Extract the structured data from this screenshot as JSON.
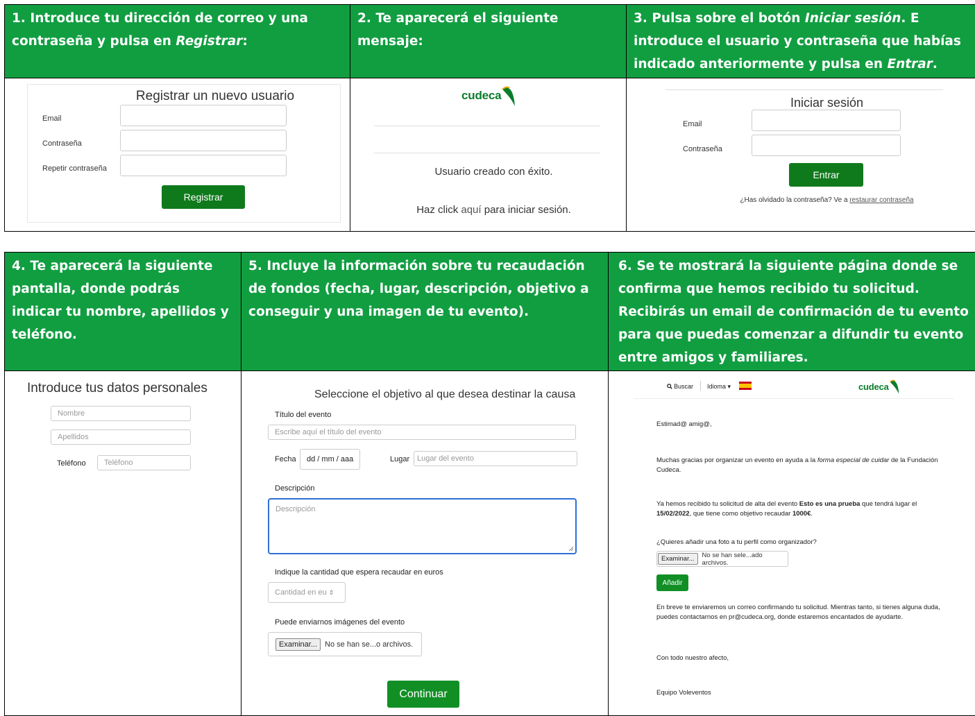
{
  "row1": {
    "step1": {
      "heading_pre": "1. Introduce tu dirección de correo y una contraseña y pulsa en ",
      "heading_em": "Registrar",
      "heading_post": ":",
      "form_title": "Registrar un nuevo usuario",
      "email_label": "Email",
      "password_label": "Contraseña",
      "repeat_label": "Repetir contraseña",
      "submit_label": "Registrar"
    },
    "step2": {
      "heading": "2. Te aparecerá el siguiente mensaje:",
      "logo_text": "cudeca",
      "success_text": "Usuario creado con éxito.",
      "click_pre": "Haz click ",
      "click_link": "aquí",
      "click_post": " para iniciar sesión."
    },
    "step3": {
      "heading_pre": "3. Pulsa sobre el botón ",
      "heading_em1": "Iniciar sesión",
      "heading_mid": ". E introduce el usuario y contraseña que habías indicado anteriormente y pulsa en ",
      "heading_em2": "Entrar",
      "heading_post": ".",
      "form_title": "Iniciar sesión",
      "email_label": "Email",
      "password_label": "Contraseña",
      "submit_label": "Entrar",
      "forgot_pre": "¿Has olvidado la contraseña? Ve a ",
      "forgot_link": "restaurar contraseña"
    }
  },
  "row2": {
    "step4": {
      "heading": "4. Te aparecerá la siguiente pantalla, donde podrás indicar tu nombre, apellidos y teléfono.",
      "form_title": "Introduce tus datos personales",
      "name_placeholder": "Nombre",
      "surname_placeholder": "Apellidos",
      "phone_label": "Teléfono",
      "phone_placeholder": "Teléfono"
    },
    "step5": {
      "heading": "5. Incluye la información sobre tu recaudación de fondos (fecha, lugar, descripción, objetivo a conseguir y una imagen de tu evento).",
      "form_title": "Seleccione el objetivo al que desea destinar la causa",
      "title_label": "Título del evento",
      "title_placeholder": "Escribe aquí el título del evento",
      "date_label": "Fecha",
      "date_value": "dd / mm / aaa",
      "place_label": "Lugar",
      "place_placeholder": "Lugar del evento",
      "desc_label": "Descripción",
      "desc_placeholder": "Descripción",
      "amount_label": "Indique la cantidad que espera recaudar en euros",
      "amount_placeholder": "Cantidad en eu",
      "images_label": "Puede enviarnos imágenes del evento",
      "browse_label": "Examinar...",
      "file_status": "No se han se...o archivos.",
      "continue_label": "Continuar"
    },
    "step6": {
      "heading": "6. Se te mostrará la siguiente página donde se confirma que hemos recibido tu solicitud. Recibirás un email de confirmación de tu evento para que puedas comenzar a difundir tu evento entre amigos y familiares.",
      "search_label": "Buscar",
      "language_label": "Idioma",
      "logo_text": "cudeca",
      "greeting": "Estimad@ amig@,",
      "thanks_pre": "Muchas gracias por organizar un evento en ayuda a la ",
      "thanks_em": "forma especial de cuidar",
      "thanks_post": " de la Fundación Cudeca.",
      "received_pre": "Ya hemos recibido tu solicitud de alta del evento ",
      "received_event": "Esto es una prueba",
      "received_mid": " que tendrá lugar el ",
      "received_date": "15/02/2022",
      "received_mid2": ", que tiene como objetivo recaudar ",
      "received_goal": "1000€",
      "received_post": ".",
      "photo_question": "¿Quieres añadir una foto a tu perfil como organizador?",
      "browse_label": "Examinar...",
      "file_status": "No se han sele...ado archivos.",
      "add_label": "Añadir",
      "soon_text": "En breve te enviaremos un correo confirmando tu solicitud. Mientras tanto, si tienes alguna duda, puedes contactarnos en pr@cudeca.org, donde estaremos encantados de ayudarte.",
      "closing": "Con todo nuestro afecto,",
      "signature": "Equipo Voleventos"
    }
  }
}
